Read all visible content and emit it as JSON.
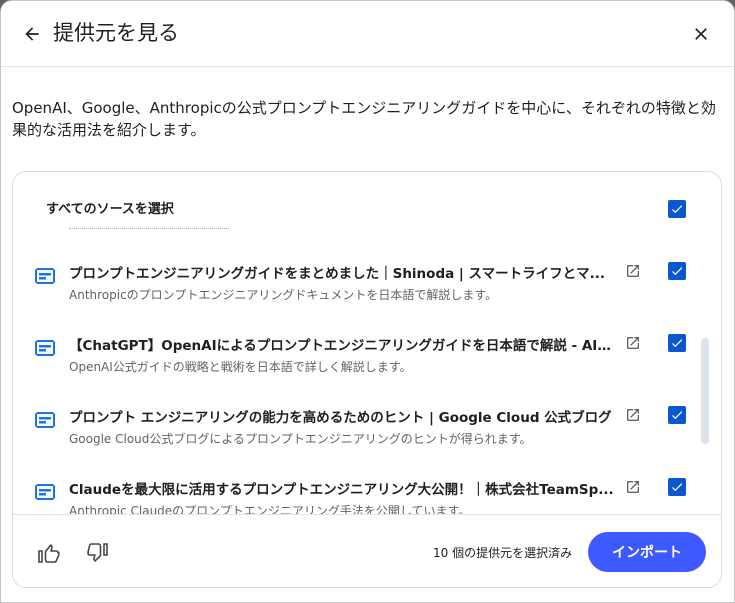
{
  "header": {
    "title": "提供元を見る"
  },
  "description": "OpenAI、Google、Anthropicの公式プロンプトエンジニアリングガイドを中心に、それぞれの特徴と効果的な活用法を紹介します。",
  "select_all": {
    "label": "すべてのソースを選択",
    "checked": true
  },
  "sources": [
    {
      "title": "プロンプトエンジニアリングガイドをまとめました｜Shinoda | スマートライフとマ...",
      "subtitle": "Anthropicのプロンプトエンジニアリングドキュメントを日本語で解説します。",
      "checked": true
    },
    {
      "title": "【ChatGPT】OpenAIによるプロンプトエンジニアリングガイドを日本語で解説 - AI ...",
      "subtitle": "OpenAI公式ガイドの戦略と戦術を日本語で詳しく解説します。",
      "checked": true
    },
    {
      "title": "プロンプト エンジニアリングの能力を高めるためのヒント | Google Cloud 公式ブログ",
      "subtitle": "Google Cloud公式ブログによるプロンプトエンジニアリングのヒントが得られます。",
      "checked": true
    },
    {
      "title": "Claudeを最大限に活用するプロンプトエンジニアリング大公開！｜株式会社TeamSp...",
      "subtitle": "Anthropic Claudeのプロンプトエンジニアリング手法を公開しています。",
      "checked": true
    }
  ],
  "footer": {
    "selected_count": "10 個の提供元を選択済み",
    "import_label": "インポート"
  },
  "colors": {
    "accent": "#0b57d0",
    "import_button": "#3d5afe",
    "doc_icon": "#1a73e8"
  }
}
